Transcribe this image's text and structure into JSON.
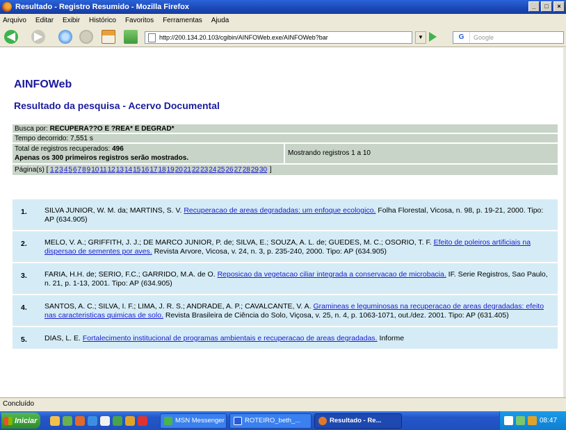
{
  "window": {
    "title": "Resultado - Registro Resumido - Mozilla Firefox"
  },
  "menubar": [
    "Arquivo",
    "Editar",
    "Exibir",
    "Histórico",
    "Favoritos",
    "Ferramentas",
    "Ajuda"
  ],
  "navbar": {
    "url": "http://200.134.20.103/cgibin/AINFOWeb.exe/AINFOWeb?bar",
    "search_placeholder": "Google",
    "icons": [
      "back-icon",
      "forward-icon",
      "reload-icon",
      "stop-icon",
      "home-icon",
      "bookmark-icon",
      "go-icon"
    ]
  },
  "page": {
    "app_title": "AINFOWeb",
    "heading": "Resultado da pesquisa - Acervo Documental"
  },
  "search_info": {
    "query_label": "Busca por:",
    "query": "RECUPERA??O E ?REA* E DEGRAD*",
    "time": "Tempo decorrido: 7,551 s",
    "total_label": "Total de registros recuperados:",
    "total": "496",
    "limit_note": "Apenas os 300 primeiros registros serão mostrados.",
    "showing": "Mostrando registros 1 a 10",
    "pages_label": "Página(s) [",
    "pages": [
      "1",
      "2",
      "3",
      "4",
      "5",
      "6",
      "7",
      "8",
      "9",
      "10",
      "11",
      "12",
      "13",
      "14",
      "15",
      "16",
      "17",
      "18",
      "19",
      "20",
      "21",
      "22",
      "23",
      "24",
      "25",
      "26",
      "27",
      "28",
      "29",
      "30"
    ],
    "pages_end": "]"
  },
  "results": [
    {
      "num": "1.",
      "before": "SILVA JUNIOR, W. M. da; MARTINS, S. V. ",
      "link": "Recuperacao de areas degradadas: um enfoque ecologico.",
      "after": " Folha Florestal, Vicosa, n. 98, p. 19-21, 2000. Tipo: AP (634.905)"
    },
    {
      "num": "2.",
      "before": "MELO, V. A.; GRIFFITH, J. J.; DE MARCO JUNIOR, P. de; SILVA, E.; SOUZA, A. L. de; GUEDES, M. C.; OSORIO, T. F. ",
      "link": "Efeito de poleiros artificiais na dispersao de sementes por aves.",
      "after": " Revista Arvore, Vicosa, v. 24, n. 3, p. 235-240, 2000. Tipo: AP (634.905)"
    },
    {
      "num": "3.",
      "before": "FARIA, H.H. de; SERIO, F.C.; GARRIDO, M.A. de O. ",
      "link": "Reposicao da vegetacao ciliar integrada a conservacao de microbacia.",
      "after": " IF. Serie Registros, Sao Paulo, n. 21, p. 1-13, 2001. Tipo: AP (634.905)"
    },
    {
      "num": "4.",
      "before": "SANTOS, A. C.; SILVA, I. F.; LIMA, J. R. S.; ANDRADE, A. P.; CAVALCANTE, V. A. ",
      "link": "Gramineas e leguminosas na recuperacao de areas degradadas: efeito nas caracteristicas quimicas de solo.",
      "after": " Revista Brasileira de Ciência do Solo, Viçosa, v. 25, n. 4, p. 1063-1071, out./dez. 2001. Tipo: AP (631.405)"
    },
    {
      "num": "5.",
      "before": "DIAS, L. E. ",
      "link": "Fortalecimento institucional de programas ambientais e recuperacao de areas degradadas.",
      "after": " Informe"
    }
  ],
  "statusbar": {
    "text": "Concluído"
  },
  "taskbar": {
    "start": "Iniciar",
    "items": [
      "MSN Messenger",
      "ROTEIRO_beth_...",
      "Resultado - Re..."
    ],
    "clock": "08:47"
  }
}
